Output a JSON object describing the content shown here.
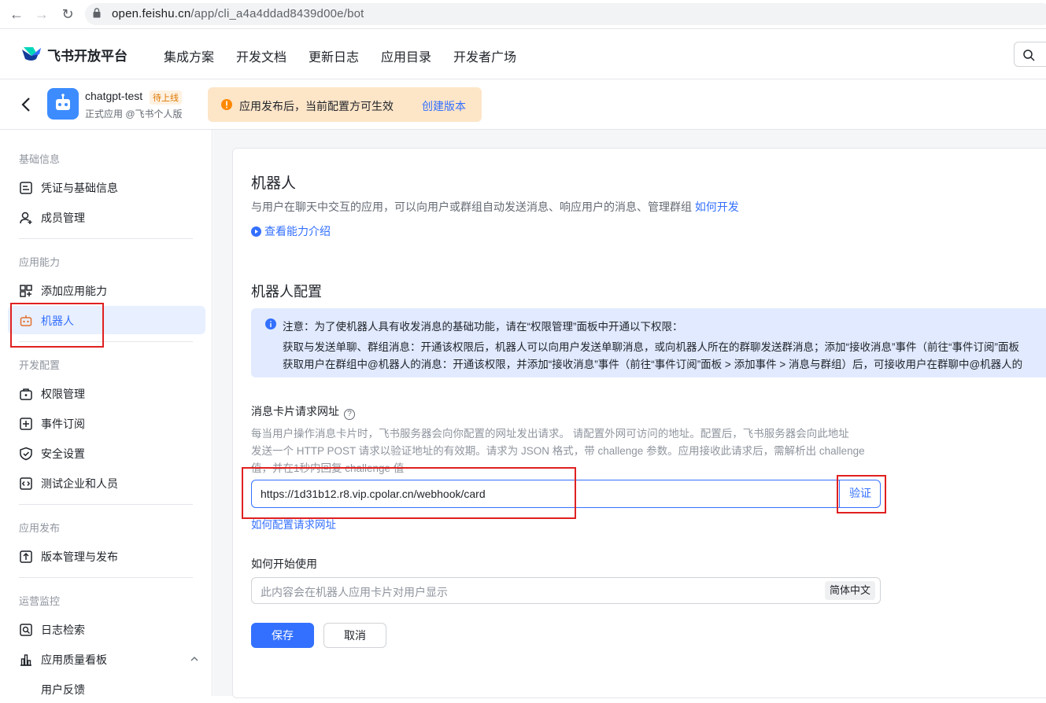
{
  "browser": {
    "url_host": "open.feishu.cn",
    "url_path": "/app/cli_a4a4ddad8439d00e/bot"
  },
  "topnav": {
    "brand": "飞书开放平台",
    "items": [
      "集成方案",
      "开发文档",
      "更新日志",
      "应用目录",
      "开发者广场"
    ]
  },
  "appbar": {
    "app_name": "chatgpt-test",
    "badge": "待上线",
    "sub": "正式应用 @飞书个人版",
    "notice_text": "应用发布后，当前配置方可生效",
    "notice_link": "创建版本"
  },
  "sidebar": {
    "groups": [
      "基础信息",
      "应用能力",
      "开发配置",
      "应用发布",
      "运营监控"
    ],
    "items": [
      {
        "label": "凭证与基础信息",
        "icon": "credential-icon"
      },
      {
        "label": "成员管理",
        "icon": "member-icon"
      },
      {
        "label": "添加应用能力",
        "icon": "add-capability-icon"
      },
      {
        "label": "机器人",
        "icon": "robot-icon"
      },
      {
        "label": "权限管理",
        "icon": "permission-icon"
      },
      {
        "label": "事件订阅",
        "icon": "event-icon"
      },
      {
        "label": "安全设置",
        "icon": "shield-icon"
      },
      {
        "label": "测试企业和人员",
        "icon": "test-icon"
      },
      {
        "label": "版本管理与发布",
        "icon": "release-icon"
      },
      {
        "label": "日志检索",
        "icon": "log-search-icon"
      },
      {
        "label": "应用质量看板",
        "icon": "chart-icon"
      },
      {
        "label": "用户反馈",
        "icon": ""
      }
    ]
  },
  "main": {
    "title": "机器人",
    "desc": "与用户在聊天中交互的应用，可以向用户或群组自动发送消息、响应用户的消息、管理群组",
    "desc_link": "如何开发",
    "intro_link": "查看能力介绍",
    "config_title": "机器人配置",
    "info": {
      "line1": "注意：为了使机器人具有收发消息的基础功能，请在“权限管理”面板中开通以下权限：",
      "line2": "获取与发送单聊、群组消息：开通该权限后，机器人可以向用户发送单聊消息，或向机器人所在的群聊发送群消息；添加“接收消息”事件（前往“事件订阅”面板",
      "line3": "获取用户在群组中@机器人的消息：开通该权限，并添加“接收消息”事件（前往“事件订阅”面板 > 添加事件 > 消息与群组）后，可接收用户在群聊中@机器人的"
    },
    "card_url_label": "消息卡片请求网址",
    "card_url_hint1": "每当用户操作消息卡片时，飞书服务器会向你配置的网址发出请求。 请配置外网可访问的地址。配置后，飞书服务器会向此地址",
    "card_url_hint2": "发送一个 HTTP POST 请求以验证地址的有效期。请求为 JSON 格式，带 challenge 参数。应用接收此请求后，需解析出 challenge",
    "card_url_hint3": "值，并在1秒内回复 challenge 值",
    "card_url_value": "https://1d31b12.r8.vip.cpolar.cn/webhook/card",
    "verify_label": "验证",
    "config_link": "如何配置请求网址",
    "usage_label": "如何开始使用",
    "usage_placeholder": "此内容会在机器人应用卡片对用户显示",
    "lang_tag": "简体中文",
    "save_label": "保存",
    "cancel_label": "取消"
  },
  "colors": {
    "accent": "#3370ff",
    "highlight_box": "#e02020",
    "notice_bg": "#fde5c8",
    "info_bg": "#e1eaff"
  }
}
